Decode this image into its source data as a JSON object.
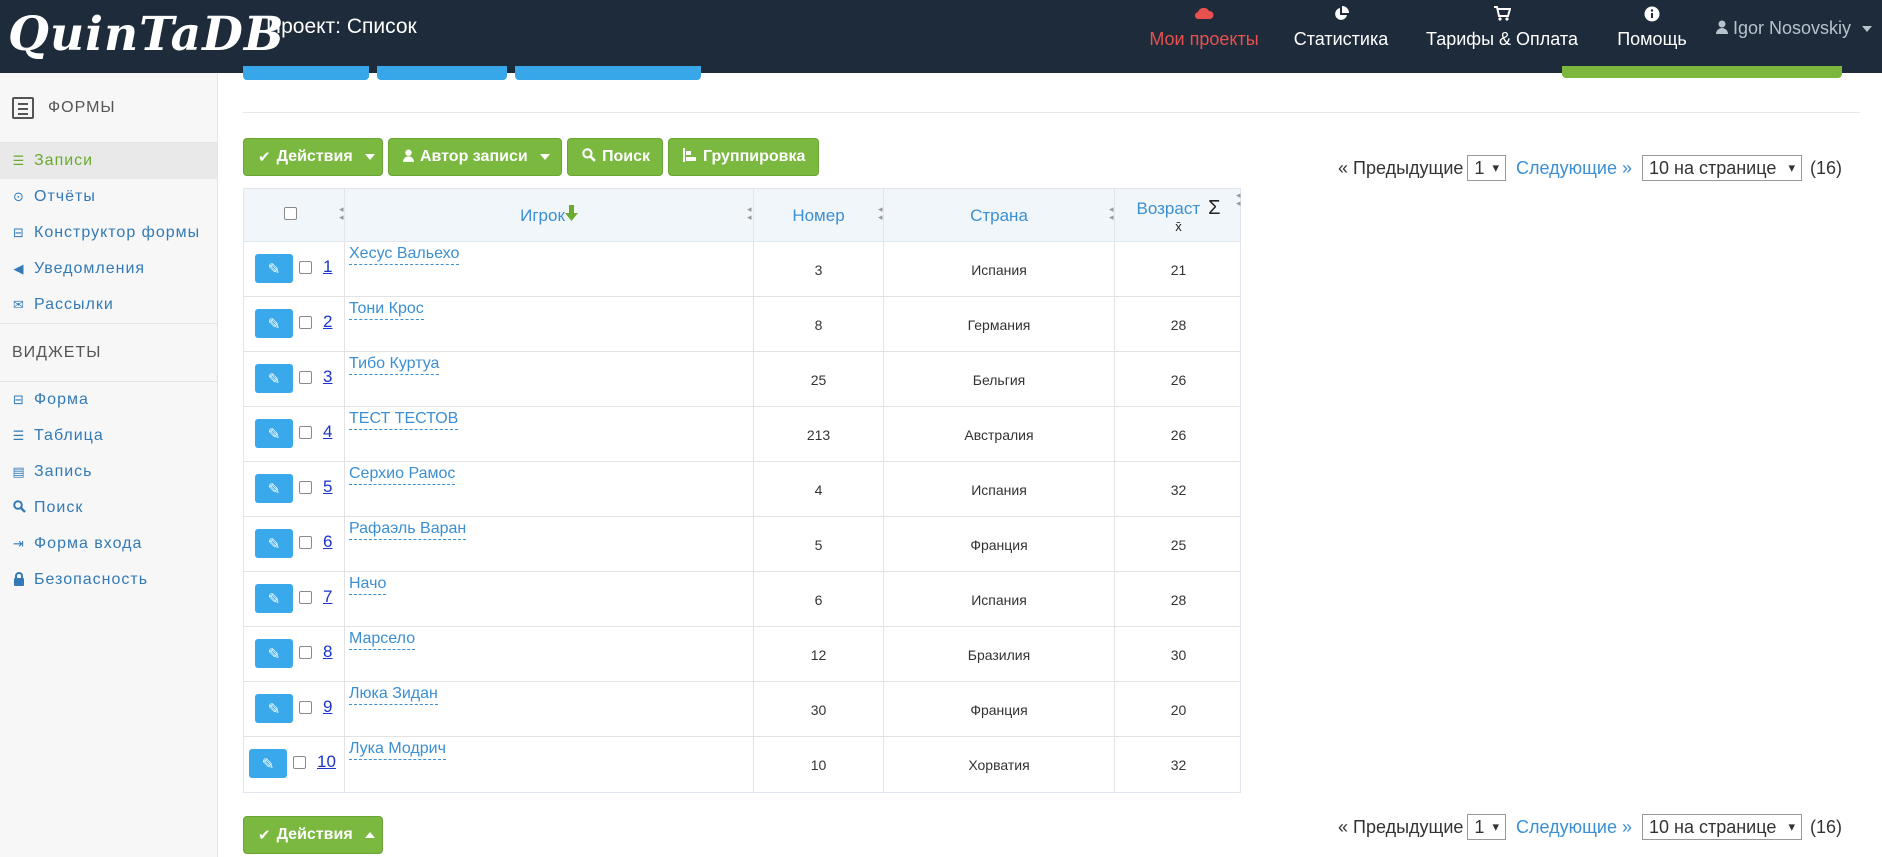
{
  "app": {
    "logo": "QuinTaDB",
    "project_title": "Проект: Список"
  },
  "nav": {
    "items": [
      {
        "label": "Мои проекты",
        "icon": "cloud-icon"
      },
      {
        "label": "Статистика",
        "icon": "pie-chart-icon"
      },
      {
        "label": "Тарифы & Оплата",
        "icon": "cart-icon"
      },
      {
        "label": "Помощь",
        "icon": "info-icon"
      }
    ],
    "user": "Igor Nosovskiy"
  },
  "sidebar": {
    "forms_header": "ФОРМЫ",
    "form_items": [
      {
        "label": "Записи",
        "icon": "list-icon",
        "active": true
      },
      {
        "label": "Отчёты",
        "icon": "dot-circle-icon"
      },
      {
        "label": "Конструктор формы",
        "icon": "form-icon"
      },
      {
        "label": "Уведомления",
        "icon": "bullhorn-icon"
      },
      {
        "label": "Рассылки",
        "icon": "envelope-icon"
      }
    ],
    "widgets_header": "ВИДЖЕТЫ",
    "widget_items": [
      {
        "label": "Форма",
        "icon": "form-icon"
      },
      {
        "label": "Таблица",
        "icon": "list-icon"
      },
      {
        "label": "Запись",
        "icon": "record-icon"
      },
      {
        "label": "Поиск",
        "icon": "search-icon"
      },
      {
        "label": "Форма входа",
        "icon": "sign-in-icon"
      },
      {
        "label": "Безопасность",
        "icon": "lock-icon"
      }
    ]
  },
  "toolbar": {
    "actions": "Действия",
    "author": "Автор записи",
    "search": "Поиск",
    "grouping": "Группировка"
  },
  "pager": {
    "prev": "« Предыдущие",
    "page": "1",
    "next": "Следующие »",
    "per_page": "10 на странице",
    "total": "(16)"
  },
  "table": {
    "columns": {
      "player": "Игрок",
      "number": "Номер",
      "country": "Страна",
      "age": "Возраст",
      "sum": "Σ",
      "avg": "x̄"
    },
    "rows": [
      {
        "n": "1",
        "player": "Хесус Вальехо",
        "number": "3",
        "country": "Испания",
        "age": "21"
      },
      {
        "n": "2",
        "player": "Тони Крос",
        "number": "8",
        "country": "Германия",
        "age": "28"
      },
      {
        "n": "3",
        "player": "Тибо Куртуа",
        "number": "25",
        "country": "Бельгия",
        "age": "26"
      },
      {
        "n": "4",
        "player": "ТЕСТ ТЕСТОВ",
        "number": "213",
        "country": "Австралия",
        "age": "26"
      },
      {
        "n": "5",
        "player": "Серхио Рамос",
        "number": "4",
        "country": "Испания",
        "age": "32"
      },
      {
        "n": "6",
        "player": "Рафаэль Варан",
        "number": "5",
        "country": "Франция",
        "age": "25"
      },
      {
        "n": "7",
        "player": "Начо",
        "number": "6",
        "country": "Испания",
        "age": "28"
      },
      {
        "n": "8",
        "player": "Марсело",
        "number": "12",
        "country": "Бразилия",
        "age": "30"
      },
      {
        "n": "9",
        "player": "Люка Зидан",
        "number": "30",
        "country": "Франция",
        "age": "20"
      },
      {
        "n": "10",
        "player": "Лука Модрич",
        "number": "10",
        "country": "Хорватия",
        "age": "32"
      }
    ]
  },
  "colors": {
    "navbar_bg": "#1d2b3a",
    "active_nav": "#e9514f",
    "button_green": "#7ab840",
    "edit_blue": "#3aa9ec",
    "link_blue": "#3b8fd2"
  }
}
